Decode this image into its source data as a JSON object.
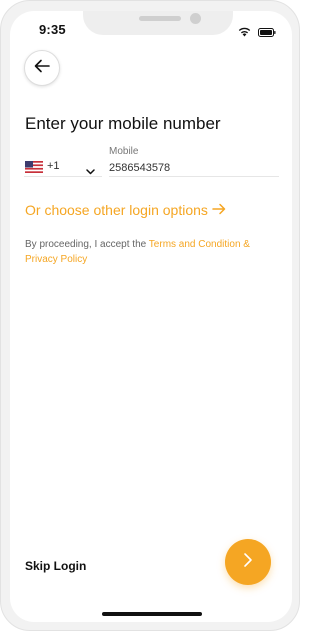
{
  "status_bar": {
    "time": "9:35",
    "icons": [
      "wifi-icon",
      "battery-icon"
    ]
  },
  "header": {
    "back_icon": "arrow-left-icon"
  },
  "title": "Enter your mobile number",
  "phone": {
    "country_flag": "us-flag-icon",
    "dial_code": "+1",
    "mobile_label": "Mobile",
    "mobile_value": "2586543578"
  },
  "other_login": {
    "label": "Or choose other login options",
    "icon": "arrow-right-icon"
  },
  "terms": {
    "prefix": "By proceeding, I accept the ",
    "link_text": "Terms and Condition & Privacy Policy"
  },
  "footer": {
    "skip_label": "Skip Login",
    "next_icon": "chevron-right-icon"
  },
  "colors": {
    "accent": "#f5a623",
    "text": "#111111",
    "muted": "#666666"
  }
}
